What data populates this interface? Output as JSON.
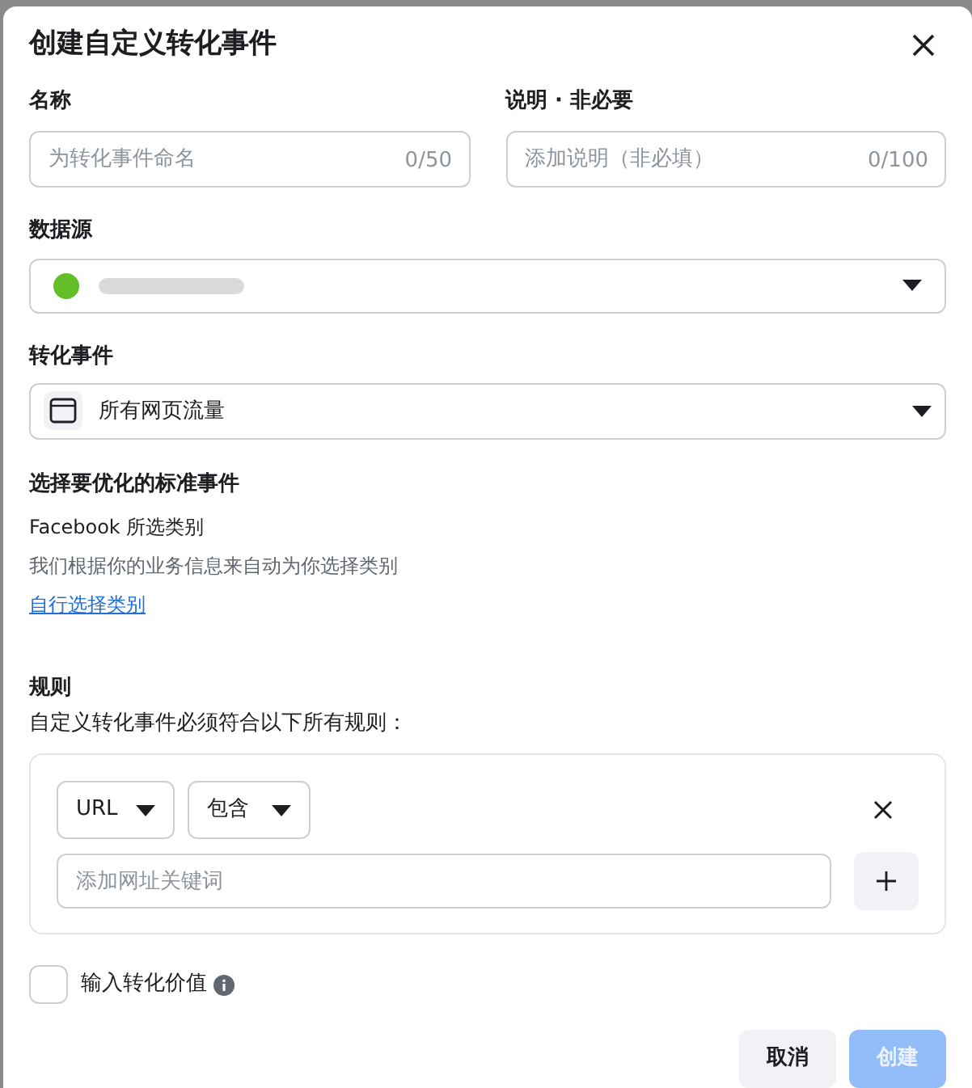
{
  "dialog": {
    "title": "创建自定义转化事件"
  },
  "name_field": {
    "label": "名称",
    "placeholder": "为转化事件命名",
    "counter": "0/50"
  },
  "description_field": {
    "label": "说明 · 非必要",
    "placeholder": "添加说明（非必填）",
    "counter": "0/100"
  },
  "data_source": {
    "label": "数据源",
    "color": "#63be28"
  },
  "conversion_event": {
    "label": "转化事件",
    "value": "所有网页流量"
  },
  "standard_event": {
    "heading": "选择要优化的标准事件",
    "category": "Facebook 所选类别",
    "hint": "我们根据你的业务信息来自动为你选择类别",
    "link": "自行选择类别"
  },
  "rules": {
    "heading": "规则",
    "description": "自定义转化事件必须符合以下所有规则：",
    "rule": {
      "field": "URL",
      "operator": "包含",
      "placeholder": "添加网址关键词"
    }
  },
  "value_checkbox": {
    "label": "输入转化价值",
    "checked": false
  },
  "buttons": [
    {
      "label": "取消",
      "kind": "secondary",
      "disabled": false
    },
    {
      "label": "创建",
      "kind": "primary",
      "disabled": true
    }
  ]
}
